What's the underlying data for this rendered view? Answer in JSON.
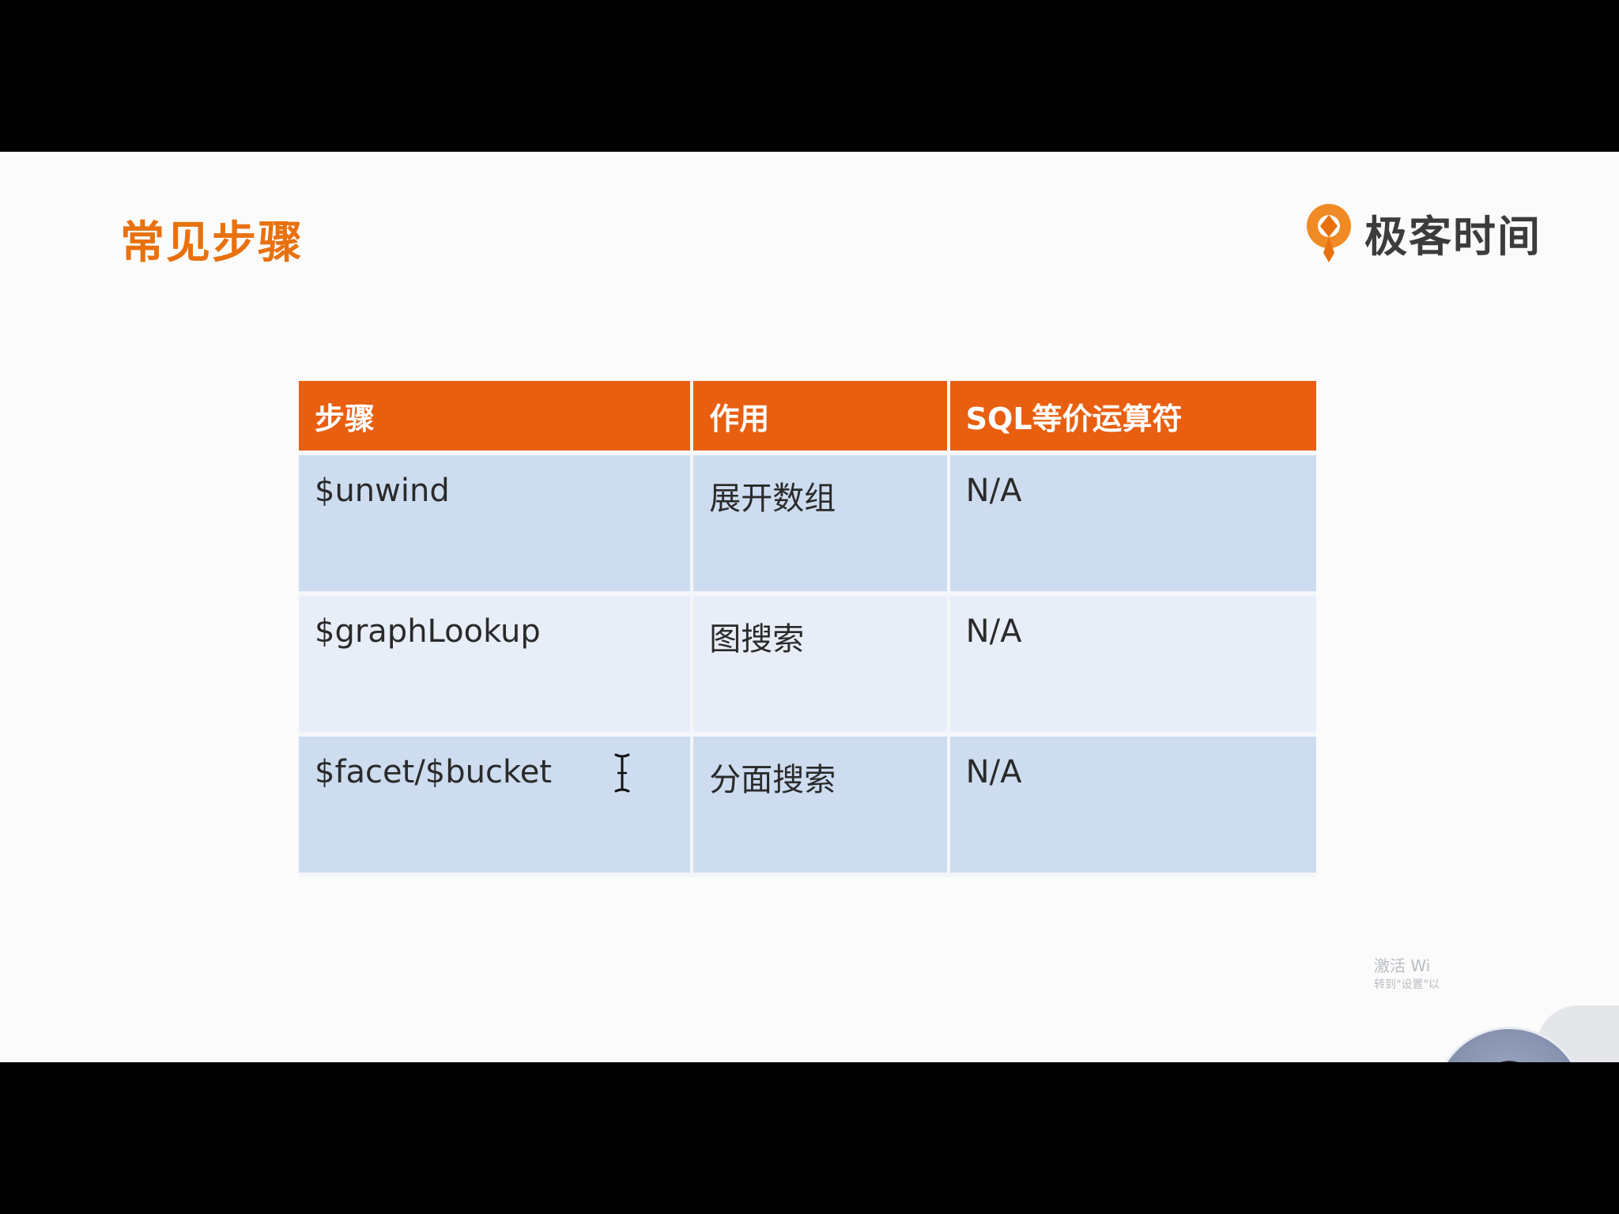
{
  "slide": {
    "title": "常见步骤",
    "logo_text": "极客时间",
    "logo_color": "#e8710e"
  },
  "table": {
    "header_color": "#e85f10",
    "headers": [
      "步骤",
      "作用",
      "SQL等价运算符"
    ],
    "rows": [
      [
        "$unwind",
        "展开数组",
        "N/A"
      ],
      [
        "$graphLookup",
        "图搜索",
        "N/A"
      ],
      [
        "$facet/$bucket",
        "分面搜索",
        "N/A"
      ]
    ]
  },
  "overlay": {
    "watermark_line1": "激活 Wi",
    "watermark_line2": "转到\"设置\"以"
  },
  "icons": {
    "cursor": "text-cursor-icon",
    "logo": "geektime-logo-icon",
    "presenter": "presenter-video-avatar"
  }
}
